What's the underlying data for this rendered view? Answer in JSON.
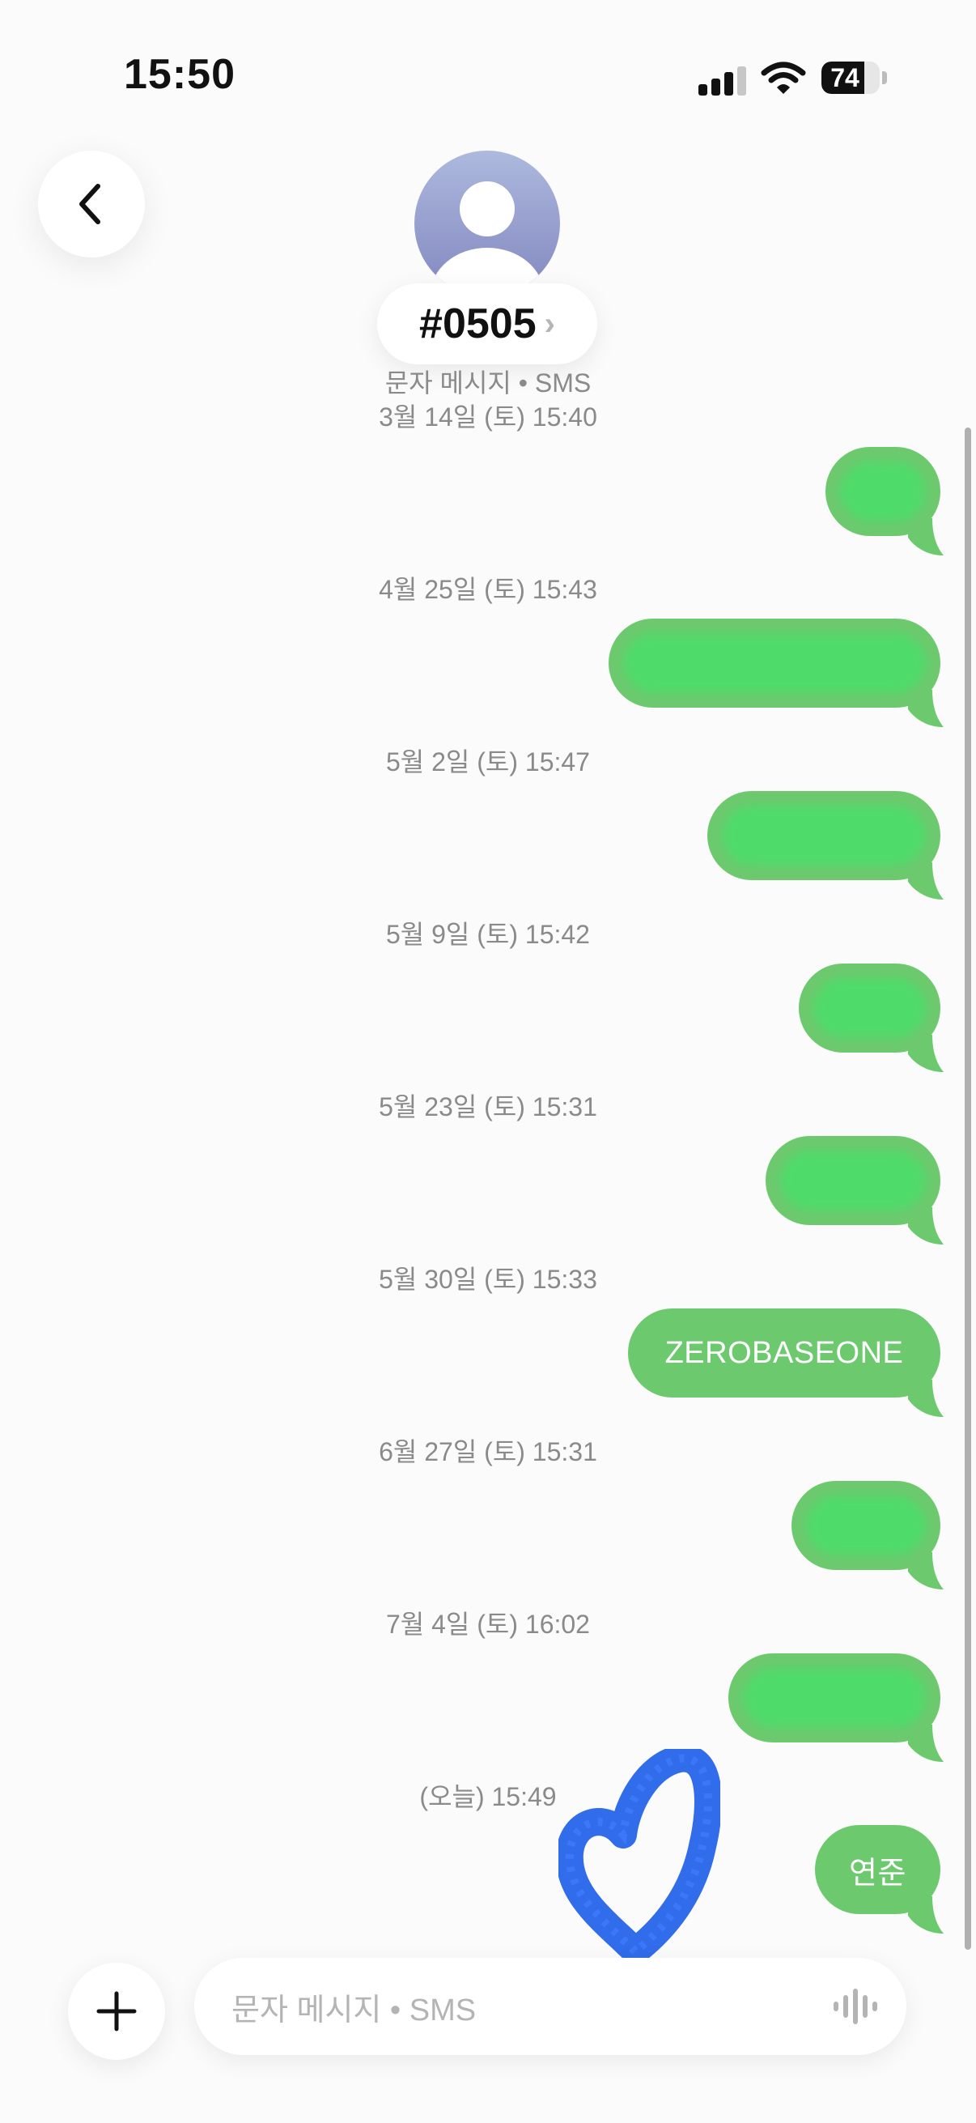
{
  "status_bar": {
    "time": "15:50",
    "battery_level": "74",
    "battery_fraction": 0.74
  },
  "header": {
    "contact_name": "#0505",
    "service_label": "문자 메시지 • SMS"
  },
  "messages": [
    {
      "date": "3월 14일",
      "day": "(토)",
      "time": "15:40",
      "text": ""
    },
    {
      "date": "4월 25일",
      "day": "(토)",
      "time": "15:43",
      "text": ""
    },
    {
      "date": "5월 2일",
      "day": "(토)",
      "time": "15:47",
      "text": ""
    },
    {
      "date": "5월 9일",
      "day": "(토)",
      "time": "15:42",
      "text": ""
    },
    {
      "date": "5월 23일",
      "day": "(토)",
      "time": "15:31",
      "text": ""
    },
    {
      "date": "5월 30일",
      "day": "(토)",
      "time": "15:33",
      "text": "ZEROBASEONE"
    },
    {
      "date": "6월 27일",
      "day": "(토)",
      "time": "15:31",
      "text": ""
    },
    {
      "date": "7월 4일",
      "day": "(토)",
      "time": "16:02",
      "text": ""
    },
    {
      "date": "",
      "day": "(오늘)",
      "time": "15:49",
      "text": "연준"
    }
  ],
  "composer": {
    "placeholder": "문자 메시지 • SMS"
  },
  "icons": {
    "back": "chevron-left-icon",
    "add": "plus-icon",
    "audio": "waveform-icon",
    "signal": "cellular-signal-icon",
    "wifi": "wifi-icon",
    "battery": "battery-icon",
    "avatar": "person-icon",
    "sticker": "heart-icon"
  },
  "colors": {
    "bubble": "#6dc96e",
    "redacted": "#4fdb6a",
    "heart": "#1f5fe8",
    "avatar_top": "#adb9de",
    "avatar_bottom": "#8287bf"
  }
}
